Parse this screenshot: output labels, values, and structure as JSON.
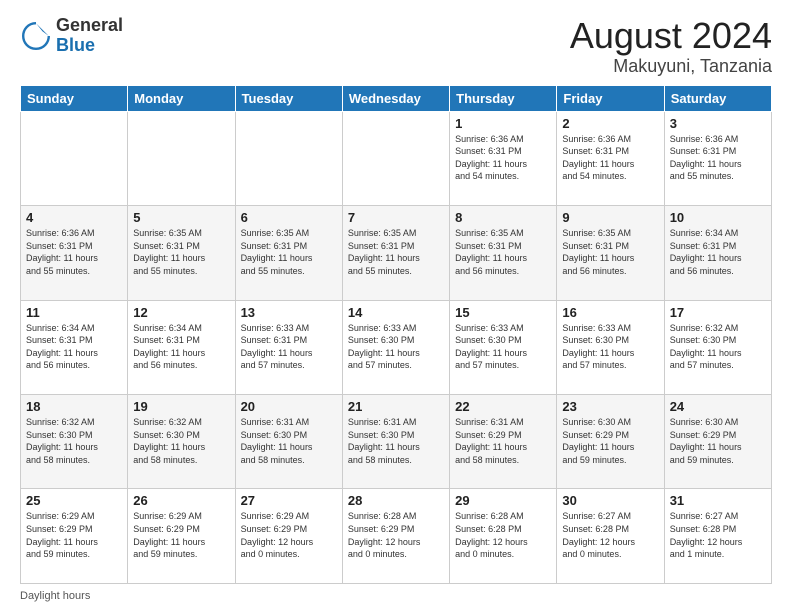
{
  "header": {
    "logo_general": "General",
    "logo_blue": "Blue",
    "month_title": "August 2024",
    "location": "Makuyuni, Tanzania"
  },
  "days_of_week": [
    "Sunday",
    "Monday",
    "Tuesday",
    "Wednesday",
    "Thursday",
    "Friday",
    "Saturday"
  ],
  "weeks": [
    [
      {
        "day": "",
        "info": ""
      },
      {
        "day": "",
        "info": ""
      },
      {
        "day": "",
        "info": ""
      },
      {
        "day": "",
        "info": ""
      },
      {
        "day": "1",
        "info": "Sunrise: 6:36 AM\nSunset: 6:31 PM\nDaylight: 11 hours\nand 54 minutes."
      },
      {
        "day": "2",
        "info": "Sunrise: 6:36 AM\nSunset: 6:31 PM\nDaylight: 11 hours\nand 54 minutes."
      },
      {
        "day": "3",
        "info": "Sunrise: 6:36 AM\nSunset: 6:31 PM\nDaylight: 11 hours\nand 55 minutes."
      }
    ],
    [
      {
        "day": "4",
        "info": "Sunrise: 6:36 AM\nSunset: 6:31 PM\nDaylight: 11 hours\nand 55 minutes."
      },
      {
        "day": "5",
        "info": "Sunrise: 6:35 AM\nSunset: 6:31 PM\nDaylight: 11 hours\nand 55 minutes."
      },
      {
        "day": "6",
        "info": "Sunrise: 6:35 AM\nSunset: 6:31 PM\nDaylight: 11 hours\nand 55 minutes."
      },
      {
        "day": "7",
        "info": "Sunrise: 6:35 AM\nSunset: 6:31 PM\nDaylight: 11 hours\nand 55 minutes."
      },
      {
        "day": "8",
        "info": "Sunrise: 6:35 AM\nSunset: 6:31 PM\nDaylight: 11 hours\nand 56 minutes."
      },
      {
        "day": "9",
        "info": "Sunrise: 6:35 AM\nSunset: 6:31 PM\nDaylight: 11 hours\nand 56 minutes."
      },
      {
        "day": "10",
        "info": "Sunrise: 6:34 AM\nSunset: 6:31 PM\nDaylight: 11 hours\nand 56 minutes."
      }
    ],
    [
      {
        "day": "11",
        "info": "Sunrise: 6:34 AM\nSunset: 6:31 PM\nDaylight: 11 hours\nand 56 minutes."
      },
      {
        "day": "12",
        "info": "Sunrise: 6:34 AM\nSunset: 6:31 PM\nDaylight: 11 hours\nand 56 minutes."
      },
      {
        "day": "13",
        "info": "Sunrise: 6:33 AM\nSunset: 6:31 PM\nDaylight: 11 hours\nand 57 minutes."
      },
      {
        "day": "14",
        "info": "Sunrise: 6:33 AM\nSunset: 6:30 PM\nDaylight: 11 hours\nand 57 minutes."
      },
      {
        "day": "15",
        "info": "Sunrise: 6:33 AM\nSunset: 6:30 PM\nDaylight: 11 hours\nand 57 minutes."
      },
      {
        "day": "16",
        "info": "Sunrise: 6:33 AM\nSunset: 6:30 PM\nDaylight: 11 hours\nand 57 minutes."
      },
      {
        "day": "17",
        "info": "Sunrise: 6:32 AM\nSunset: 6:30 PM\nDaylight: 11 hours\nand 57 minutes."
      }
    ],
    [
      {
        "day": "18",
        "info": "Sunrise: 6:32 AM\nSunset: 6:30 PM\nDaylight: 11 hours\nand 58 minutes."
      },
      {
        "day": "19",
        "info": "Sunrise: 6:32 AM\nSunset: 6:30 PM\nDaylight: 11 hours\nand 58 minutes."
      },
      {
        "day": "20",
        "info": "Sunrise: 6:31 AM\nSunset: 6:30 PM\nDaylight: 11 hours\nand 58 minutes."
      },
      {
        "day": "21",
        "info": "Sunrise: 6:31 AM\nSunset: 6:30 PM\nDaylight: 11 hours\nand 58 minutes."
      },
      {
        "day": "22",
        "info": "Sunrise: 6:31 AM\nSunset: 6:29 PM\nDaylight: 11 hours\nand 58 minutes."
      },
      {
        "day": "23",
        "info": "Sunrise: 6:30 AM\nSunset: 6:29 PM\nDaylight: 11 hours\nand 59 minutes."
      },
      {
        "day": "24",
        "info": "Sunrise: 6:30 AM\nSunset: 6:29 PM\nDaylight: 11 hours\nand 59 minutes."
      }
    ],
    [
      {
        "day": "25",
        "info": "Sunrise: 6:29 AM\nSunset: 6:29 PM\nDaylight: 11 hours\nand 59 minutes."
      },
      {
        "day": "26",
        "info": "Sunrise: 6:29 AM\nSunset: 6:29 PM\nDaylight: 11 hours\nand 59 minutes."
      },
      {
        "day": "27",
        "info": "Sunrise: 6:29 AM\nSunset: 6:29 PM\nDaylight: 12 hours\nand 0 minutes."
      },
      {
        "day": "28",
        "info": "Sunrise: 6:28 AM\nSunset: 6:29 PM\nDaylight: 12 hours\nand 0 minutes."
      },
      {
        "day": "29",
        "info": "Sunrise: 6:28 AM\nSunset: 6:28 PM\nDaylight: 12 hours\nand 0 minutes."
      },
      {
        "day": "30",
        "info": "Sunrise: 6:27 AM\nSunset: 6:28 PM\nDaylight: 12 hours\nand 0 minutes."
      },
      {
        "day": "31",
        "info": "Sunrise: 6:27 AM\nSunset: 6:28 PM\nDaylight: 12 hours\nand 1 minute."
      }
    ]
  ],
  "footer": {
    "daylight_label": "Daylight hours"
  }
}
